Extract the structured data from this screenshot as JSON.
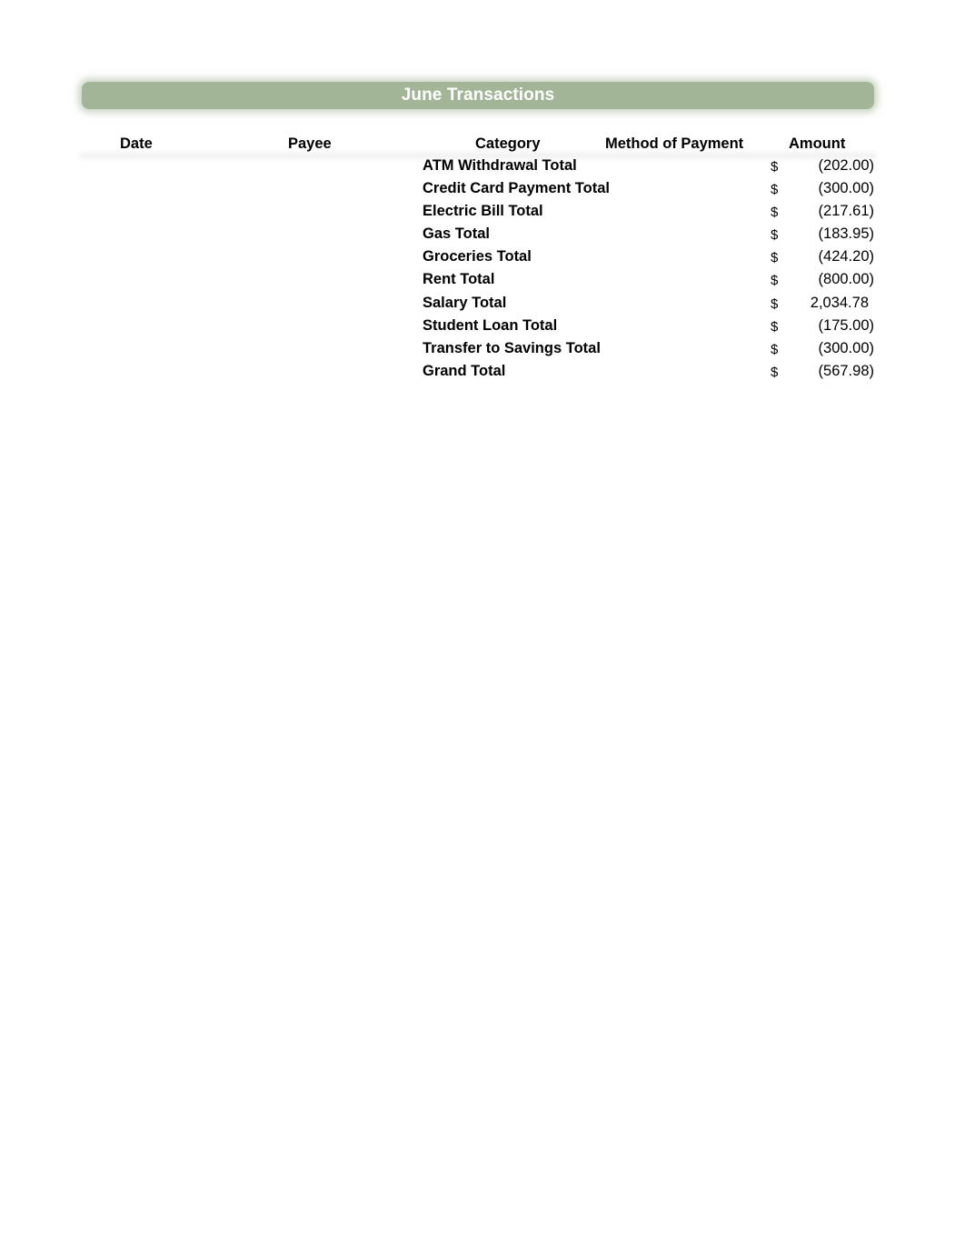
{
  "sheet": {
    "title": "June Transactions",
    "colors": {
      "title_bar": "#a2b596",
      "title_text": "#ffffff"
    },
    "headers": {
      "date": "Date",
      "payee": "Payee",
      "category": "Category",
      "method": "Method of Payment",
      "amount": "Amount"
    },
    "rows": [
      {
        "label": "ATM Withdrawal Total",
        "currency": "$",
        "amount": "(202.00)",
        "value": -202.0
      },
      {
        "label": "Credit Card Payment Total",
        "currency": "$",
        "amount": "(300.00)",
        "value": -300.0
      },
      {
        "label": "Electric Bill Total",
        "currency": "$",
        "amount": "(217.61)",
        "value": -217.61
      },
      {
        "label": "Gas Total",
        "currency": "$",
        "amount": "(183.95)",
        "value": -183.95
      },
      {
        "label": "Groceries Total",
        "currency": "$",
        "amount": "(424.20)",
        "value": -424.2
      },
      {
        "label": "Rent Total",
        "currency": "$",
        "amount": "(800.00)",
        "value": -800.0
      },
      {
        "label": "Salary Total",
        "currency": "$",
        "amount": "2,034.78",
        "value": 2034.78
      },
      {
        "label": "Student Loan Total",
        "currency": "$",
        "amount": "(175.00)",
        "value": -175.0
      },
      {
        "label": "Transfer to Savings Total",
        "currency": "$",
        "amount": "(300.00)",
        "value": -300.0
      },
      {
        "label": "Grand Total",
        "currency": "$",
        "amount": "(567.98)",
        "value": -567.98
      }
    ]
  }
}
